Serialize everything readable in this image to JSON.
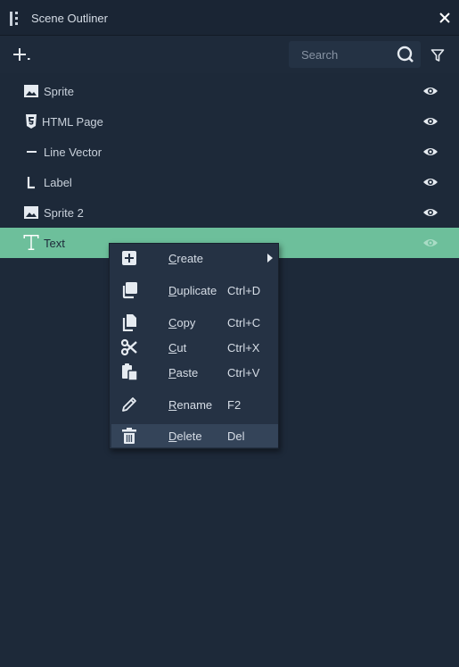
{
  "window": {
    "title": "Scene Outliner"
  },
  "toolbar": {
    "search_placeholder": "Search"
  },
  "tree": {
    "items": [
      {
        "label": "Sprite",
        "icon": "image-icon"
      },
      {
        "label": "HTML Page",
        "icon": "html5-icon"
      },
      {
        "label": "Line Vector",
        "icon": "line-icon"
      },
      {
        "label": "Label",
        "icon": "label-icon"
      },
      {
        "label": "Sprite 2",
        "icon": "image-icon"
      },
      {
        "label": "Text",
        "icon": "text-icon",
        "selected": true
      }
    ]
  },
  "context_menu": {
    "items": [
      {
        "label": "Create",
        "shortcut": "",
        "submenu": true
      },
      {
        "label": "Duplicate",
        "shortcut": "Ctrl+D"
      },
      {
        "label": "Copy",
        "shortcut": "Ctrl+C"
      },
      {
        "label": "Cut",
        "shortcut": "Ctrl+X"
      },
      {
        "label": "Paste",
        "shortcut": "Ctrl+V"
      },
      {
        "label": "Rename",
        "shortcut": "F2"
      },
      {
        "label": "Delete",
        "shortcut": "Del",
        "highlighted": true
      }
    ]
  },
  "colors": {
    "background": "#1d2939",
    "selected_row": "#6dbf9b",
    "menu_background": "#253244",
    "menu_highlight": "#344459"
  }
}
